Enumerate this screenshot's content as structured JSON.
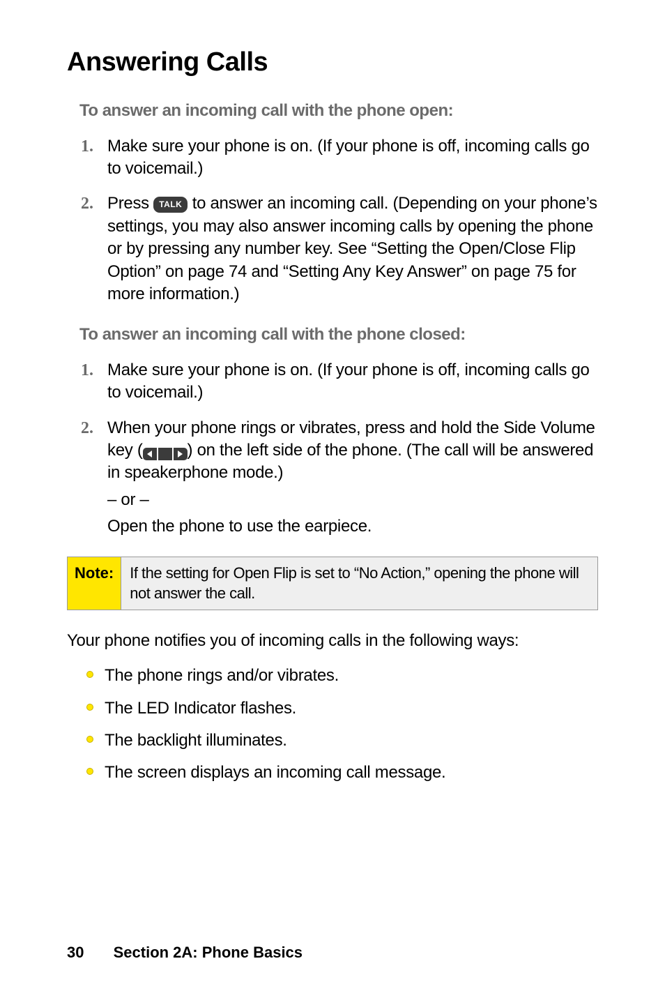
{
  "heading": "Answering Calls",
  "sub_open": "To answer an incoming call with the phone open:",
  "open_steps": {
    "s1_num": "1.",
    "s1": "Make sure your phone is on. (If your phone is off, incoming calls go to voicemail.)",
    "s2_num": "2.",
    "s2a": "Press ",
    "talk_label": "TALK",
    "s2b": " to answer an incoming call. (Depending on your phone’s settings, you may also answer incoming calls by opening the phone or by pressing any number key. See “Setting the Open/Close Flip Option” on page 74 and “Setting Any Key Answer” on page 75 for more information.)"
  },
  "sub_closed": "To answer an incoming call with the phone closed:",
  "closed_steps": {
    "s1_num": "1.",
    "s1": "Make sure your phone is on. (If your phone is off, incoming calls go to voicemail.)",
    "s2_num": "2.",
    "s2a": "When your phone rings or vibrates, press and hold the Side Volume key (",
    "s2b": ") on the left side of the phone. (The call will be answered in speakerphone mode.)",
    "or": "– or –",
    "s2c": "Open the phone to use the earpiece."
  },
  "note": {
    "label": "Note:",
    "body": "If the setting for Open Flip is set to “No Action,” opening the phone will not answer the call."
  },
  "para_notify": "Your phone notifies you of incoming calls in the following ways:",
  "bullets": {
    "b1": "The phone rings and/or vibrates.",
    "b2": "The LED Indicator flashes.",
    "b3": "The backlight illuminates.",
    "b4": "The screen displays an incoming call message."
  },
  "footer": {
    "page": "30",
    "section": "Section 2A: Phone Basics"
  }
}
